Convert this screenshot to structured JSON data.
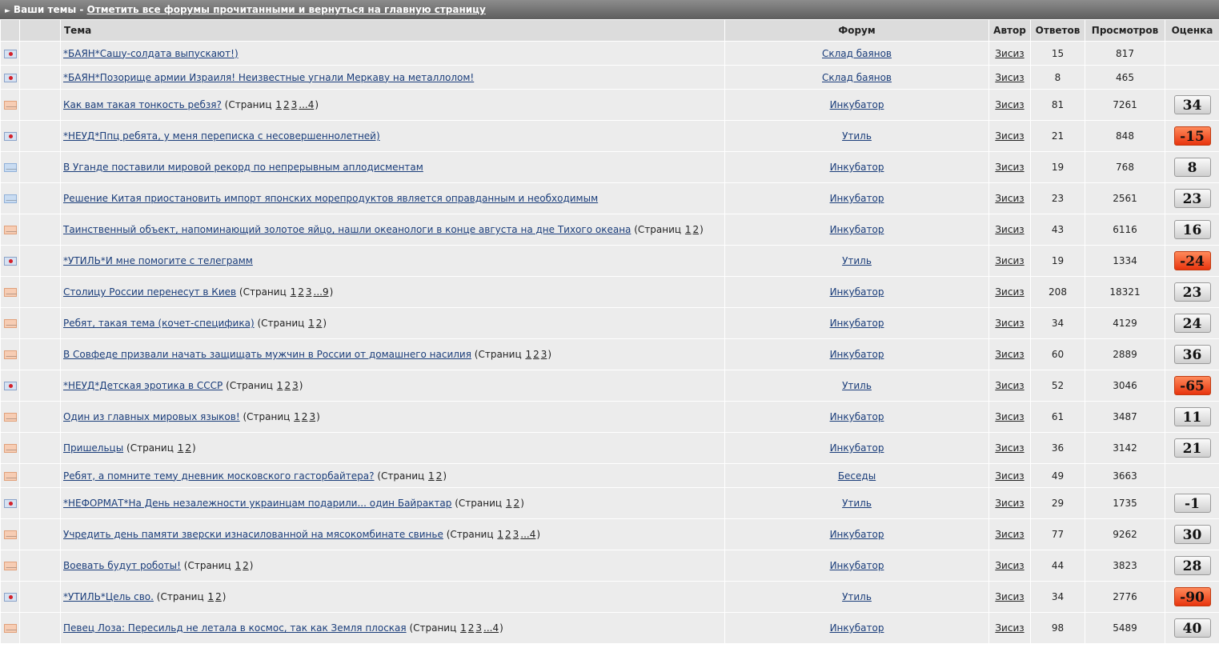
{
  "header": {
    "section_title": "Ваши темы",
    "separator": " - ",
    "mark_read_link": "Отметить все форумы прочитанными и вернуться на главную страницу"
  },
  "columns": {
    "topic": "Тема",
    "forum": "Форум",
    "author": "Автор",
    "replies": "Ответов",
    "views": "Просмотров",
    "rating": "Оценка"
  },
  "pages_label": "Страниц",
  "topics": [
    {
      "icon": "sticky",
      "title": "*БАЯН*Сашу-солдата выпускают!)",
      "pages": [],
      "forum": "Склад баянов",
      "author": "Зисиз",
      "replies": "15",
      "views": "817",
      "rating": "",
      "rating_type": "",
      "size": "short"
    },
    {
      "icon": "sticky",
      "title": "*БАЯН*Позорище армии Израиля! Неизвестные угнали Меркаву на металлолом!",
      "pages": [],
      "forum": "Склад баянов",
      "author": "Зисиз",
      "replies": "8",
      "views": "465",
      "rating": "",
      "rating_type": "",
      "size": "short"
    },
    {
      "icon": "env-orange",
      "title": "Как вам такая тонкость ребзя?",
      "pages": [
        "1",
        "2",
        "3",
        "...4"
      ],
      "forum": "Инкубатор",
      "author": "Зисиз",
      "replies": "81",
      "views": "7261",
      "rating": "34",
      "rating_type": "pos",
      "size": "tall"
    },
    {
      "icon": "sticky",
      "title": "*НЕУД*Ппц ребята, у меня переписка с несовершеннолетней)",
      "pages": [],
      "forum": "Утиль",
      "author": "Зисиз",
      "replies": "21",
      "views": "848",
      "rating": "-15",
      "rating_type": "neg",
      "size": "tall"
    },
    {
      "icon": "env-blue",
      "title": "В Уганде поставили мировой рекорд по непрерывным аплодисментам",
      "pages": [],
      "forum": "Инкубатор",
      "author": "Зисиз",
      "replies": "19",
      "views": "768",
      "rating": "8",
      "rating_type": "pos",
      "size": "tall"
    },
    {
      "icon": "env-blue",
      "title": "Решение Китая приостановить импорт японских морепродуктов является оправданным и необходимым",
      "pages": [],
      "forum": "Инкубатор",
      "author": "Зисиз",
      "replies": "23",
      "views": "2561",
      "rating": "23",
      "rating_type": "pos",
      "size": "tall"
    },
    {
      "icon": "env-orange",
      "title": "Таинственный объект, напоминающий золотое яйцо, нашли океанологи в конце августа на дне Тихого океана",
      "pages": [
        "1",
        "2"
      ],
      "forum": "Инкубатор",
      "author": "Зисиз",
      "replies": "43",
      "views": "6116",
      "rating": "16",
      "rating_type": "pos",
      "size": "tall"
    },
    {
      "icon": "sticky",
      "title": "*УТИЛЬ*И мне помогите с телеграмм",
      "pages": [],
      "forum": "Утиль",
      "author": "Зисиз",
      "replies": "19",
      "views": "1334",
      "rating": "-24",
      "rating_type": "neg",
      "size": "tall"
    },
    {
      "icon": "env-orange",
      "title": "Столицу России перенесут в Киев",
      "pages": [
        "1",
        "2",
        "3",
        "...9"
      ],
      "forum": "Инкубатор",
      "author": "Зисиз",
      "replies": "208",
      "views": "18321",
      "rating": "23",
      "rating_type": "pos",
      "size": "tall"
    },
    {
      "icon": "env-orange",
      "title": "Ребят, такая тема (кочет-специфика)",
      "pages": [
        "1",
        "2"
      ],
      "forum": "Инкубатор",
      "author": "Зисиз",
      "replies": "34",
      "views": "4129",
      "rating": "24",
      "rating_type": "pos",
      "size": "tall"
    },
    {
      "icon": "env-orange",
      "title": "В Совфеде призвали начать защищать мужчин в России от домашнего насилия",
      "pages": [
        "1",
        "2",
        "3"
      ],
      "forum": "Инкубатор",
      "author": "Зисиз",
      "replies": "60",
      "views": "2889",
      "rating": "36",
      "rating_type": "pos",
      "size": "tall"
    },
    {
      "icon": "sticky",
      "title": "*НЕУД*Детская эротика в СССР",
      "pages": [
        "1",
        "2",
        "3"
      ],
      "forum": "Утиль",
      "author": "Зисиз",
      "replies": "52",
      "views": "3046",
      "rating": "-65",
      "rating_type": "neg",
      "size": "tall"
    },
    {
      "icon": "env-orange",
      "title": "Один из главных мировых языков!",
      "pages": [
        "1",
        "2",
        "3"
      ],
      "forum": "Инкубатор",
      "author": "Зисиз",
      "replies": "61",
      "views": "3487",
      "rating": "11",
      "rating_type": "pos",
      "size": "tall"
    },
    {
      "icon": "env-orange",
      "title": "Пришельцы",
      "pages": [
        "1",
        "2"
      ],
      "forum": "Инкубатор",
      "author": "Зисиз",
      "replies": "36",
      "views": "3142",
      "rating": "21",
      "rating_type": "pos",
      "size": "tall"
    },
    {
      "icon": "env-orange",
      "title": "Ребят, а помните тему дневник московского гасторбайтера?",
      "pages": [
        "1",
        "2"
      ],
      "forum": "Беседы",
      "author": "Зисиз",
      "replies": "49",
      "views": "3663",
      "rating": "",
      "rating_type": "",
      "size": "short"
    },
    {
      "icon": "sticky",
      "title": "*НЕФОРМАТ*На День незалежности украинцам подарили... один Байрактар",
      "pages": [
        "1",
        "2"
      ],
      "forum": "Утиль",
      "author": "Зисиз",
      "replies": "29",
      "views": "1735",
      "rating": "-1",
      "rating_type": "pos",
      "size": "tall"
    },
    {
      "icon": "env-orange",
      "title": "Учредить день памяти зверски изнасилованной на мясокомбинате свинье",
      "pages": [
        "1",
        "2",
        "3",
        "...4"
      ],
      "forum": "Инкубатор",
      "author": "Зисиз",
      "replies": "77",
      "views": "9262",
      "rating": "30",
      "rating_type": "pos",
      "size": "tall"
    },
    {
      "icon": "env-orange",
      "title": "Воевать будут роботы!",
      "pages": [
        "1",
        "2"
      ],
      "forum": "Инкубатор",
      "author": "Зисиз",
      "replies": "44",
      "views": "3823",
      "rating": "28",
      "rating_type": "pos",
      "size": "tall"
    },
    {
      "icon": "sticky",
      "title": "*УТИЛЬ*Цель сво.",
      "pages": [
        "1",
        "2"
      ],
      "forum": "Утиль",
      "author": "Зисиз",
      "replies": "34",
      "views": "2776",
      "rating": "-90",
      "rating_type": "neg",
      "size": "tall"
    },
    {
      "icon": "env-orange",
      "title": "Певец Лоза: Пересильд не летала в космос, так как Земля плоская",
      "pages": [
        "1",
        "2",
        "3",
        "...4"
      ],
      "forum": "Инкубатор",
      "author": "Зисиз",
      "replies": "98",
      "views": "5489",
      "rating": "40",
      "rating_type": "pos",
      "size": "tall"
    }
  ]
}
